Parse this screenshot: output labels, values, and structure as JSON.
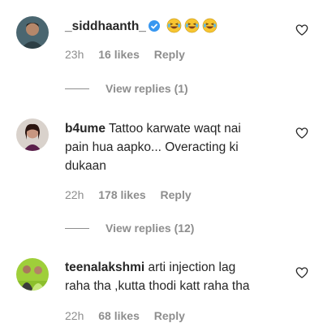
{
  "comments": [
    {
      "username": "_siddhaanth_",
      "verified": true,
      "text": "",
      "time": "23h",
      "likes": "16 likes",
      "reply": "Reply",
      "view_replies": "View replies (1)"
    },
    {
      "username": "b4ume",
      "text_line1": "Tattoo karwate waqt nai",
      "text_line2": "pain hua aapko... Overacting ki",
      "text_line3": "dukaan",
      "time": "22h",
      "likes": "178 likes",
      "reply": "Reply",
      "view_replies": "View replies (12)"
    },
    {
      "username": "teenalakshmi",
      "text_line1": "arti injection lag",
      "text_line2": "raha tha ,kutta thodi katt raha tha",
      "time": "22h",
      "likes": "68 likes",
      "reply": "Reply"
    }
  ],
  "icons": {
    "like": "heart-outline-icon",
    "verified": "verified-badge-icon",
    "emoji": "laughing-tears-emoji"
  },
  "colors": {
    "text": "#262626",
    "secondary": "#8e8e8e",
    "verified": "#3897f0",
    "emoji": "#f7c531"
  }
}
